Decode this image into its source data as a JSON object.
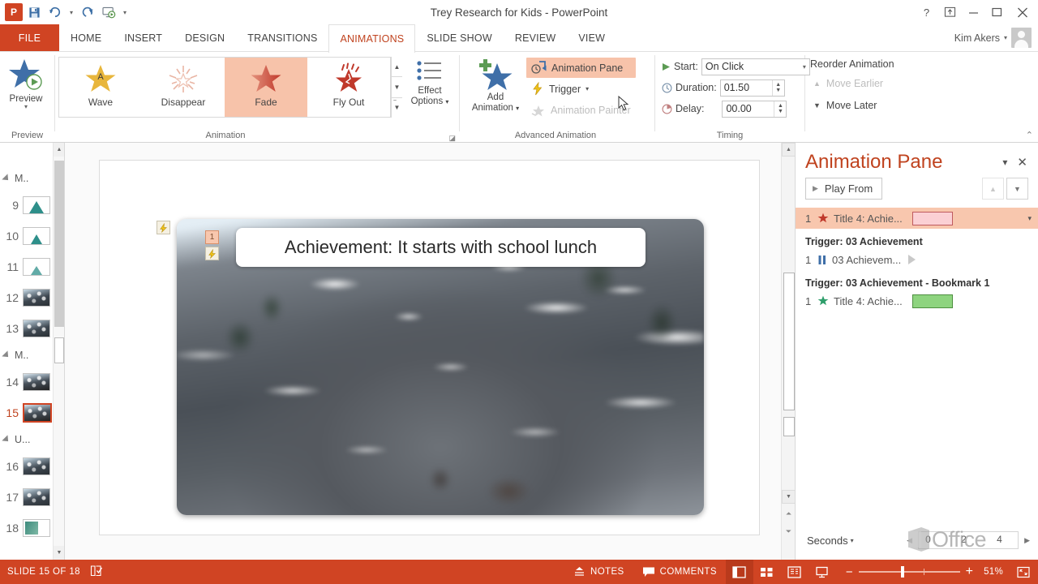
{
  "window": {
    "title": "Trey Research for Kids - PowerPoint",
    "app_icon": "powerpoint-icon",
    "quick_access": [
      {
        "name": "save-icon",
        "label": "Save"
      },
      {
        "name": "undo-icon",
        "label": "Undo"
      },
      {
        "name": "redo-icon",
        "label": "Redo"
      },
      {
        "name": "start-slideshow-icon",
        "label": "Start From Beginning"
      },
      {
        "name": "customize-qat-icon",
        "label": "Customize Quick Access Toolbar"
      }
    ],
    "controls": {
      "help": "?",
      "ribbon_display": "ribbon-display-options",
      "minimize": "minimize",
      "maximize": "maximize",
      "close": "close"
    },
    "user": "Kim Akers"
  },
  "tabs": [
    {
      "label": "FILE",
      "active": false,
      "file": true
    },
    {
      "label": "HOME",
      "active": false
    },
    {
      "label": "INSERT",
      "active": false
    },
    {
      "label": "DESIGN",
      "active": false
    },
    {
      "label": "TRANSITIONS",
      "active": false
    },
    {
      "label": "ANIMATIONS",
      "active": true
    },
    {
      "label": "SLIDE SHOW",
      "active": false
    },
    {
      "label": "REVIEW",
      "active": false
    },
    {
      "label": "VIEW",
      "active": false
    }
  ],
  "ribbon": {
    "preview": {
      "group_label": "Preview",
      "button_label": "Preview"
    },
    "animation": {
      "group_label": "Animation",
      "gallery": [
        {
          "label": "Wave",
          "icon": "star-wave-icon",
          "selected": false
        },
        {
          "label": "Disappear",
          "icon": "star-disappear-icon",
          "selected": false
        },
        {
          "label": "Fade",
          "icon": "star-fade-icon",
          "selected": true
        },
        {
          "label": "Fly Out",
          "icon": "star-fly-out-icon",
          "selected": false
        }
      ],
      "effect_options": "Effect\nOptions",
      "effect_options_line1": "Effect",
      "effect_options_line2": "Options"
    },
    "advanced": {
      "group_label": "Advanced Animation",
      "add_animation_line1": "Add",
      "add_animation_line2": "Animation",
      "animation_pane": "Animation Pane",
      "animation_pane_active": true,
      "trigger": "Trigger",
      "animation_painter": "Animation Painter",
      "animation_painter_disabled": true
    },
    "timing": {
      "group_label": "Timing",
      "start_label": "Start:",
      "start_value": "On Click",
      "duration_label": "Duration:",
      "duration_value": "01.50",
      "delay_label": "Delay:",
      "delay_value": "00.00"
    },
    "reorder": {
      "title": "Reorder Animation",
      "move_earlier": "Move Earlier",
      "move_earlier_disabled": true,
      "move_later": "Move Later"
    },
    "collapse_icon": "collapse-ribbon-icon"
  },
  "thumbnails": {
    "sections": [
      {
        "label": "M..",
        "slides": [
          {
            "number": "9",
            "thumb": "mountain",
            "selected": false
          },
          {
            "number": "10",
            "thumb": "mountain",
            "selected": false
          },
          {
            "number": "11",
            "thumb": "mountain",
            "selected": false
          },
          {
            "number": "12",
            "thumb": "photo",
            "selected": false
          },
          {
            "number": "13",
            "thumb": "photo",
            "selected": false
          }
        ]
      },
      {
        "label": "M..",
        "slides": [
          {
            "number": "14",
            "thumb": "snowy",
            "selected": false
          },
          {
            "number": "15",
            "thumb": "snowy",
            "selected": true
          }
        ]
      },
      {
        "label": "U...",
        "slides": [
          {
            "number": "16",
            "thumb": "photo",
            "selected": false
          },
          {
            "number": "17",
            "thumb": "photo",
            "selected": false
          },
          {
            "number": "18",
            "thumb": "green",
            "selected": false
          }
        ]
      }
    ]
  },
  "slide": {
    "title": "Achievement: It starts with school lunch",
    "animation_badge": "1",
    "trigger_badge_icon": "lightning-bolt-icon",
    "outside_trigger_badge_icon": "lightning-bolt-icon"
  },
  "animation_pane": {
    "title": "Animation Pane",
    "collapse_icon": "chevron-down-icon",
    "close_icon": "close-icon",
    "play_from": "Play From",
    "move_up_disabled": true,
    "move_down_disabled": false,
    "items": [
      {
        "index": "1",
        "icon": "star-red-icon",
        "name": "Title 4: Achie...",
        "bar": "pink",
        "selected": true,
        "has_caret": true
      }
    ],
    "triggers": [
      {
        "header": "Trigger: 03 Achievement",
        "items": [
          {
            "index": "1",
            "icon": "media-pause-icon",
            "name": "03 Achievem...",
            "bar": "play-marker",
            "selected": false
          }
        ]
      },
      {
        "header": "Trigger: 03 Achievement - Bookmark 1",
        "items": [
          {
            "index": "1",
            "icon": "star-green-icon",
            "name": "Title 4: Achie...",
            "bar": "green",
            "selected": false
          }
        ]
      }
    ],
    "footer": {
      "seconds": "Seconds",
      "scroll_left_icon": "chevron-left-icon",
      "scroll_right_icon": "chevron-right-icon",
      "ticks": [
        "0",
        "2",
        "4"
      ]
    },
    "watermark": "Office"
  },
  "statusbar": {
    "slide_counter": "SLIDE 15 OF 18",
    "spellcheck_icon": "spellcheck-icon",
    "notes": "NOTES",
    "notes_icon": "notes-icon",
    "comments": "COMMENTS",
    "comments_icon": "comments-icon",
    "views": [
      {
        "name": "normal-view",
        "icon": "normal-view-icon",
        "active": true
      },
      {
        "name": "slide-sorter-view",
        "icon": "slide-sorter-icon",
        "active": false
      },
      {
        "name": "reading-view",
        "icon": "reading-view-icon",
        "active": false
      },
      {
        "name": "slide-show-view",
        "icon": "slide-show-icon",
        "active": false
      }
    ],
    "zoom_out": "−",
    "zoom_in": "+",
    "zoom_percent": "51%",
    "fit_icon": "fit-slide-icon"
  },
  "colors": {
    "accent": "#d04423",
    "tab_active_text": "#c0431f",
    "highlight": "#f8c7ae",
    "green_bar": "#8ed47f",
    "pink_bar": "#fbd0d4"
  }
}
